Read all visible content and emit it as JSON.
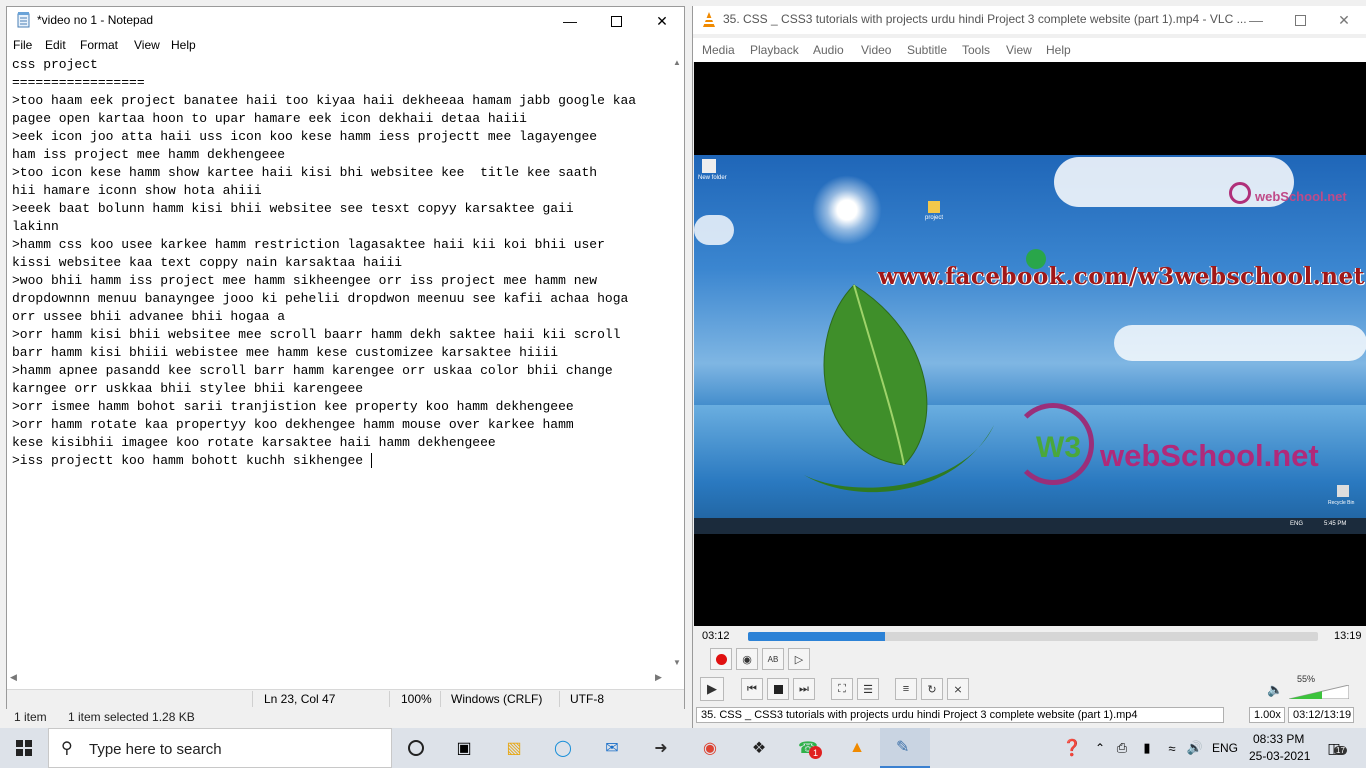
{
  "explorer": {
    "items": "1 item",
    "selected": "1 item selected  1.28 KB"
  },
  "notepad": {
    "title": "*video no 1 - Notepad",
    "menu": [
      "File",
      "Edit",
      "Format",
      "View",
      "Help"
    ],
    "lines": [
      "css project",
      "=================",
      ">too haam eek project banatee haii too kiyaa haii dekheeaa hamam jabb google kaa",
      "pagee open kartaa hoon to upar hamare eek icon dekhaii detaa haiii",
      ">eek icon joo atta haii uss icon koo kese hamm iess projectt mee lagayengee",
      "ham iss project mee hamm dekhengeee",
      ">too icon kese hamm show kartee haii kisi bhi websitee kee  title kee saath",
      "hii hamare iconn show hota ahiii",
      ">eeek baat bolunn hamm kisi bhii websitee see tesxt copyy karsaktee gaii",
      "lakinn",
      ">hamm css koo usee karkee hamm restriction lagasaktee haii kii koi bhii user",
      "kissi websitee kaa text coppy nain karsaktaa haiii",
      ">woo bhii hamm iss project mee hamm sikheengee orr iss project mee hamm new",
      "dropdownnn menuu banayngee jooo ki pehelii dropdwon meenuu see kafii achaa hoga",
      "orr ussee bhii advanee bhii hogaa a",
      ">orr hamm kisi bhii websitee mee scroll baarr hamm dekh saktee haii kii scroll",
      "barr hamm kisi bhiii webistee mee hamm kese customizee karsaktee hiiii",
      ">hamm apnee pasandd kee scroll barr hamm karengee orr uskaa color bhii change",
      "karngee orr uskkaa bhii stylee bhii karengeee",
      ">orr ismee hamm bohot sarii tranjistion kee property koo hamm dekhengeee",
      ">orr hamm rotate kaa propertyy koo dekhengee hamm mouse over karkee hamm",
      "kese kisibhii imagee koo rotate karsaktee haii hamm dekhengeee",
      ">iss projectt koo hamm bohott kuchh sikhengee "
    ],
    "status": {
      "position": "Ln 23, Col 47",
      "zoom": "100%",
      "eol": "Windows (CRLF)",
      "encoding": "UTF-8"
    }
  },
  "vlc": {
    "title": "35. CSS _ CSS3 tutorials with projects urdu hindi Project 3 complete website (part 1).mp4 - VLC ...",
    "menu": [
      "Media",
      "Playback",
      "Audio",
      "Video",
      "Subtitle",
      "Tools",
      "View",
      "Help"
    ],
    "video": {
      "desktop_icon_1": "New folder",
      "desktop_icon_2": "project",
      "facebook": "www.facebook.com/w3webschool.net",
      "logo_small": "webSchool.net",
      "logo_w3": "W3",
      "logo_big": "webSchool.net",
      "recycle": "Recycle Bin",
      "inner_lang": "ENG",
      "inner_time": "5:45 PM"
    },
    "elapsed": "03:12",
    "total": "13:19",
    "progress_fraction": 0.24,
    "volume": "55%",
    "volume_fraction": 0.55,
    "status_title": "35. CSS _ CSS3 tutorials with projects urdu hindi Project 3 complete website (part 1).mp4",
    "speed": "1.00x",
    "time": "03:12/13:19"
  },
  "taskbar": {
    "search_placeholder": "Type here to search",
    "lang": "ENG",
    "time": "08:33 PM",
    "date": "25-03-2021",
    "whatsapp_badge": "1",
    "notif_count": "17"
  },
  "colors": {
    "vlc_orange": "#f08a00",
    "seek_blue": "#2c82d6",
    "taskbar": "#dde2e9",
    "volume_green": "#3cc33c"
  }
}
